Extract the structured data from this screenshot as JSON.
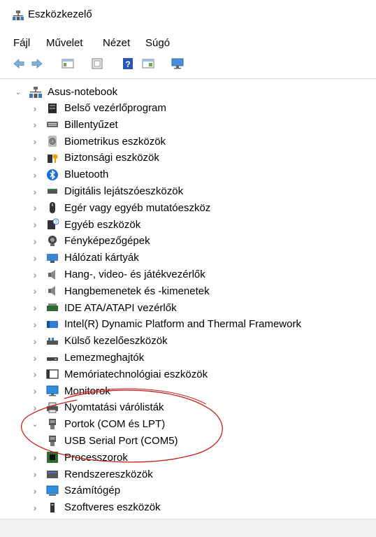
{
  "window": {
    "title": "Eszközkezelő"
  },
  "menu": [
    "Fájl",
    "Művelet",
    "Nézet",
    "Súgó"
  ],
  "toolbar": [
    {
      "name": "back-arrow-icon"
    },
    {
      "name": "forward-arrow-icon"
    },
    {
      "name": "show-hide-console-tree-icon"
    },
    {
      "name": "properties-icon"
    },
    {
      "name": "help-icon"
    },
    {
      "name": "action-pane-icon"
    },
    {
      "name": "scan-hardware-icon"
    }
  ],
  "tree": {
    "root": "Asus-notebook",
    "items": [
      {
        "label": "Belső vezérlőprogram",
        "icon": "firmware-icon",
        "expanded": false
      },
      {
        "label": "Billentyűzet",
        "icon": "keyboard-icon",
        "expanded": false
      },
      {
        "label": "Biometrikus eszközök",
        "icon": "fingerprint-icon",
        "expanded": false
      },
      {
        "label": "Biztonsági eszközök",
        "icon": "security-key-icon",
        "expanded": false
      },
      {
        "label": "Bluetooth",
        "icon": "bluetooth-icon",
        "expanded": false
      },
      {
        "label": "Digitális lejátszóeszközök",
        "icon": "media-player-icon",
        "expanded": false
      },
      {
        "label": "Egér vagy egyéb mutatóeszköz",
        "icon": "mouse-icon",
        "expanded": false
      },
      {
        "label": "Egyéb eszközök",
        "icon": "unknown-device-icon",
        "expanded": false
      },
      {
        "label": "Fényképezőgépek",
        "icon": "camera-icon",
        "expanded": false
      },
      {
        "label": "Hálózati kártyák",
        "icon": "network-adapter-icon",
        "expanded": false
      },
      {
        "label": "Hang-, video- és játékvezérlők",
        "icon": "speaker-icon",
        "expanded": false
      },
      {
        "label": "Hangbemenetek és -kimenetek",
        "icon": "speaker-icon",
        "expanded": false
      },
      {
        "label": "IDE ATA/ATAPI vezérlők",
        "icon": "ide-controller-icon",
        "expanded": false
      },
      {
        "label": "Intel(R) Dynamic Platform and Thermal Framework",
        "icon": "chip-icon",
        "expanded": false
      },
      {
        "label": "Külső kezelőeszközök",
        "icon": "hid-icon",
        "expanded": false
      },
      {
        "label": "Lemezmeghajtók",
        "icon": "disk-drive-icon",
        "expanded": false
      },
      {
        "label": "Memóriatechnológiai eszközök",
        "icon": "memory-icon",
        "expanded": false
      },
      {
        "label": "Monitorok",
        "icon": "monitor-icon",
        "expanded": false
      },
      {
        "label": "Nyomtatási várólisták",
        "icon": "printer-icon",
        "expanded": false
      },
      {
        "label": "Portok (COM és LPT)",
        "icon": "port-icon",
        "expanded": true
      },
      {
        "label": "USB Serial Port (COM5)",
        "icon": "port-icon",
        "child": true
      },
      {
        "label": "Processzorok",
        "icon": "processor-icon",
        "expanded": false
      },
      {
        "label": "Rendszereszközök",
        "icon": "system-devices-icon",
        "expanded": false
      },
      {
        "label": "Számítógép",
        "icon": "computer-icon",
        "expanded": false
      },
      {
        "label": "Szoftveres eszközök",
        "icon": "software-device-icon",
        "expanded": false
      }
    ]
  },
  "colors": {
    "annotation": "#c41f1f",
    "accent": "#2b72d8"
  }
}
